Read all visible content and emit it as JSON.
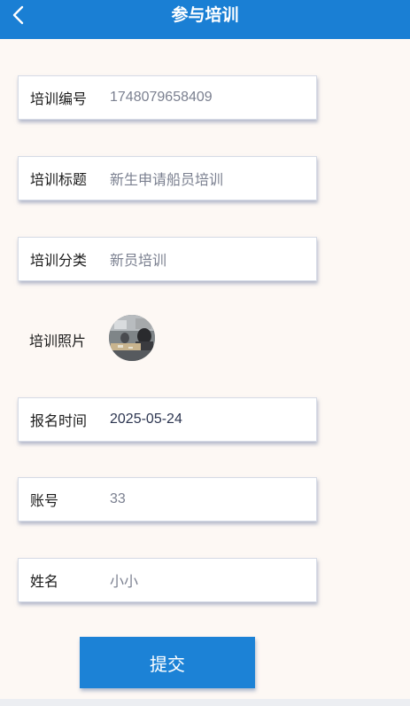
{
  "header": {
    "title": "参与培训",
    "back_icon": "chevron-left-icon",
    "bg_color": "#1a7fd4"
  },
  "form": {
    "fields": [
      {
        "label": "培训编号",
        "value": "1748079658409"
      },
      {
        "label": "培训标题",
        "value": "新生申请船员培训"
      },
      {
        "label": "培训分类",
        "value": "新员培训"
      },
      {
        "label": "报名时间",
        "value": "2025-05-24"
      },
      {
        "label": "账号",
        "value": "33"
      },
      {
        "label": "姓名",
        "value": "小小"
      }
    ],
    "photo": {
      "label": "培训照片"
    }
  },
  "submit": {
    "label": "提交",
    "color": "#1c82d6"
  }
}
